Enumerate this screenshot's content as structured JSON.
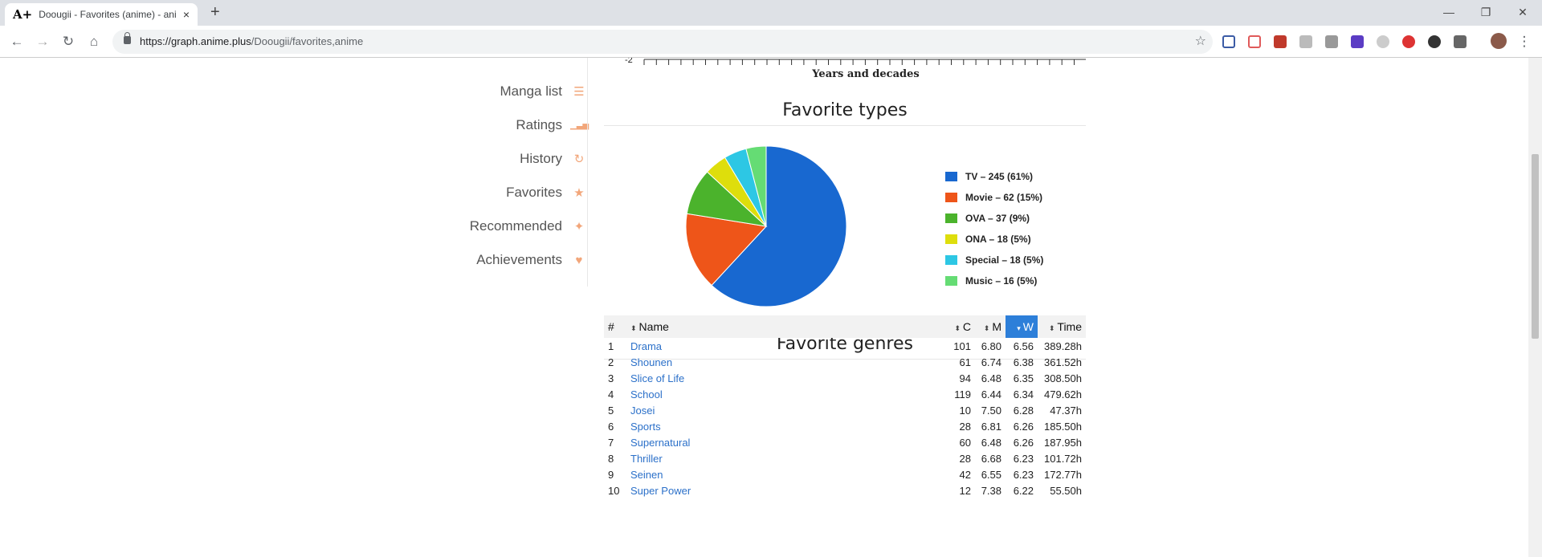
{
  "browser": {
    "tab_title": "Doougii - Favorites (anime) - ani",
    "tab_favicon": "A+",
    "url_host": "https://graph.anime.plus",
    "url_path": "/Doougii/favorites,anime",
    "new_tab": "+",
    "close": "×",
    "back": "←",
    "forward": "→",
    "reload": "↻",
    "home": "⌂",
    "bookmark": "☆",
    "minimize": "—",
    "maximize": "❐",
    "close_window": "✕",
    "menu": "⋮"
  },
  "sidebar": {
    "items": [
      {
        "label": "Manga list",
        "icon": "list-icon",
        "glyph": "☰"
      },
      {
        "label": "Ratings",
        "icon": "bar-chart-icon",
        "glyph": "▁▃▅"
      },
      {
        "label": "History",
        "icon": "history-icon",
        "glyph": "↻"
      },
      {
        "label": "Favorites",
        "icon": "star-icon",
        "glyph": "★"
      },
      {
        "label": "Recommended",
        "icon": "recommend-icon",
        "glyph": "✦"
      },
      {
        "label": "Achievements",
        "icon": "trophy-icon",
        "glyph": "♥"
      }
    ]
  },
  "timeline": {
    "tick_label": "-2",
    "xlabel": "Years and decades"
  },
  "favorite_types": {
    "title": "Favorite types",
    "legend": [
      "TV – 245 (61%)",
      "Movie – 62 (15%)",
      "OVA – 37 (9%)",
      "ONA – 18 (5%)",
      "Special – 18 (5%)",
      "Music – 16 (5%)"
    ]
  },
  "chart_data": {
    "type": "pie",
    "categories": [
      "TV",
      "Movie",
      "OVA",
      "ONA",
      "Special",
      "Music"
    ],
    "values": [
      245,
      62,
      37,
      18,
      18,
      16
    ],
    "colors": [
      "#1868d0",
      "#ee5519",
      "#4bb32c",
      "#dede0c",
      "#2dc7e4",
      "#65dc74"
    ],
    "legend_position": "right"
  },
  "favorite_genres": {
    "title": "Favorite genres",
    "headers": {
      "rank": "#",
      "name": "Name",
      "c": "C",
      "m": "M",
      "w": "W",
      "time": "Time"
    },
    "rows": [
      [
        "1",
        "Drama",
        "101",
        "6.80",
        "6.56",
        "389.28h"
      ],
      [
        "2",
        "Shounen",
        "61",
        "6.74",
        "6.38",
        "361.52h"
      ],
      [
        "3",
        "Slice of Life",
        "94",
        "6.48",
        "6.35",
        "308.50h"
      ],
      [
        "4",
        "School",
        "119",
        "6.44",
        "6.34",
        "479.62h"
      ],
      [
        "5",
        "Josei",
        "10",
        "7.50",
        "6.28",
        "47.37h"
      ],
      [
        "6",
        "Sports",
        "28",
        "6.81",
        "6.26",
        "185.50h"
      ],
      [
        "7",
        "Supernatural",
        "60",
        "6.48",
        "6.26",
        "187.95h"
      ],
      [
        "8",
        "Thriller",
        "28",
        "6.68",
        "6.23",
        "101.72h"
      ],
      [
        "9",
        "Seinen",
        "42",
        "6.55",
        "6.23",
        "172.77h"
      ],
      [
        "10",
        "Super Power",
        "12",
        "7.38",
        "6.22",
        "55.50h"
      ]
    ]
  }
}
